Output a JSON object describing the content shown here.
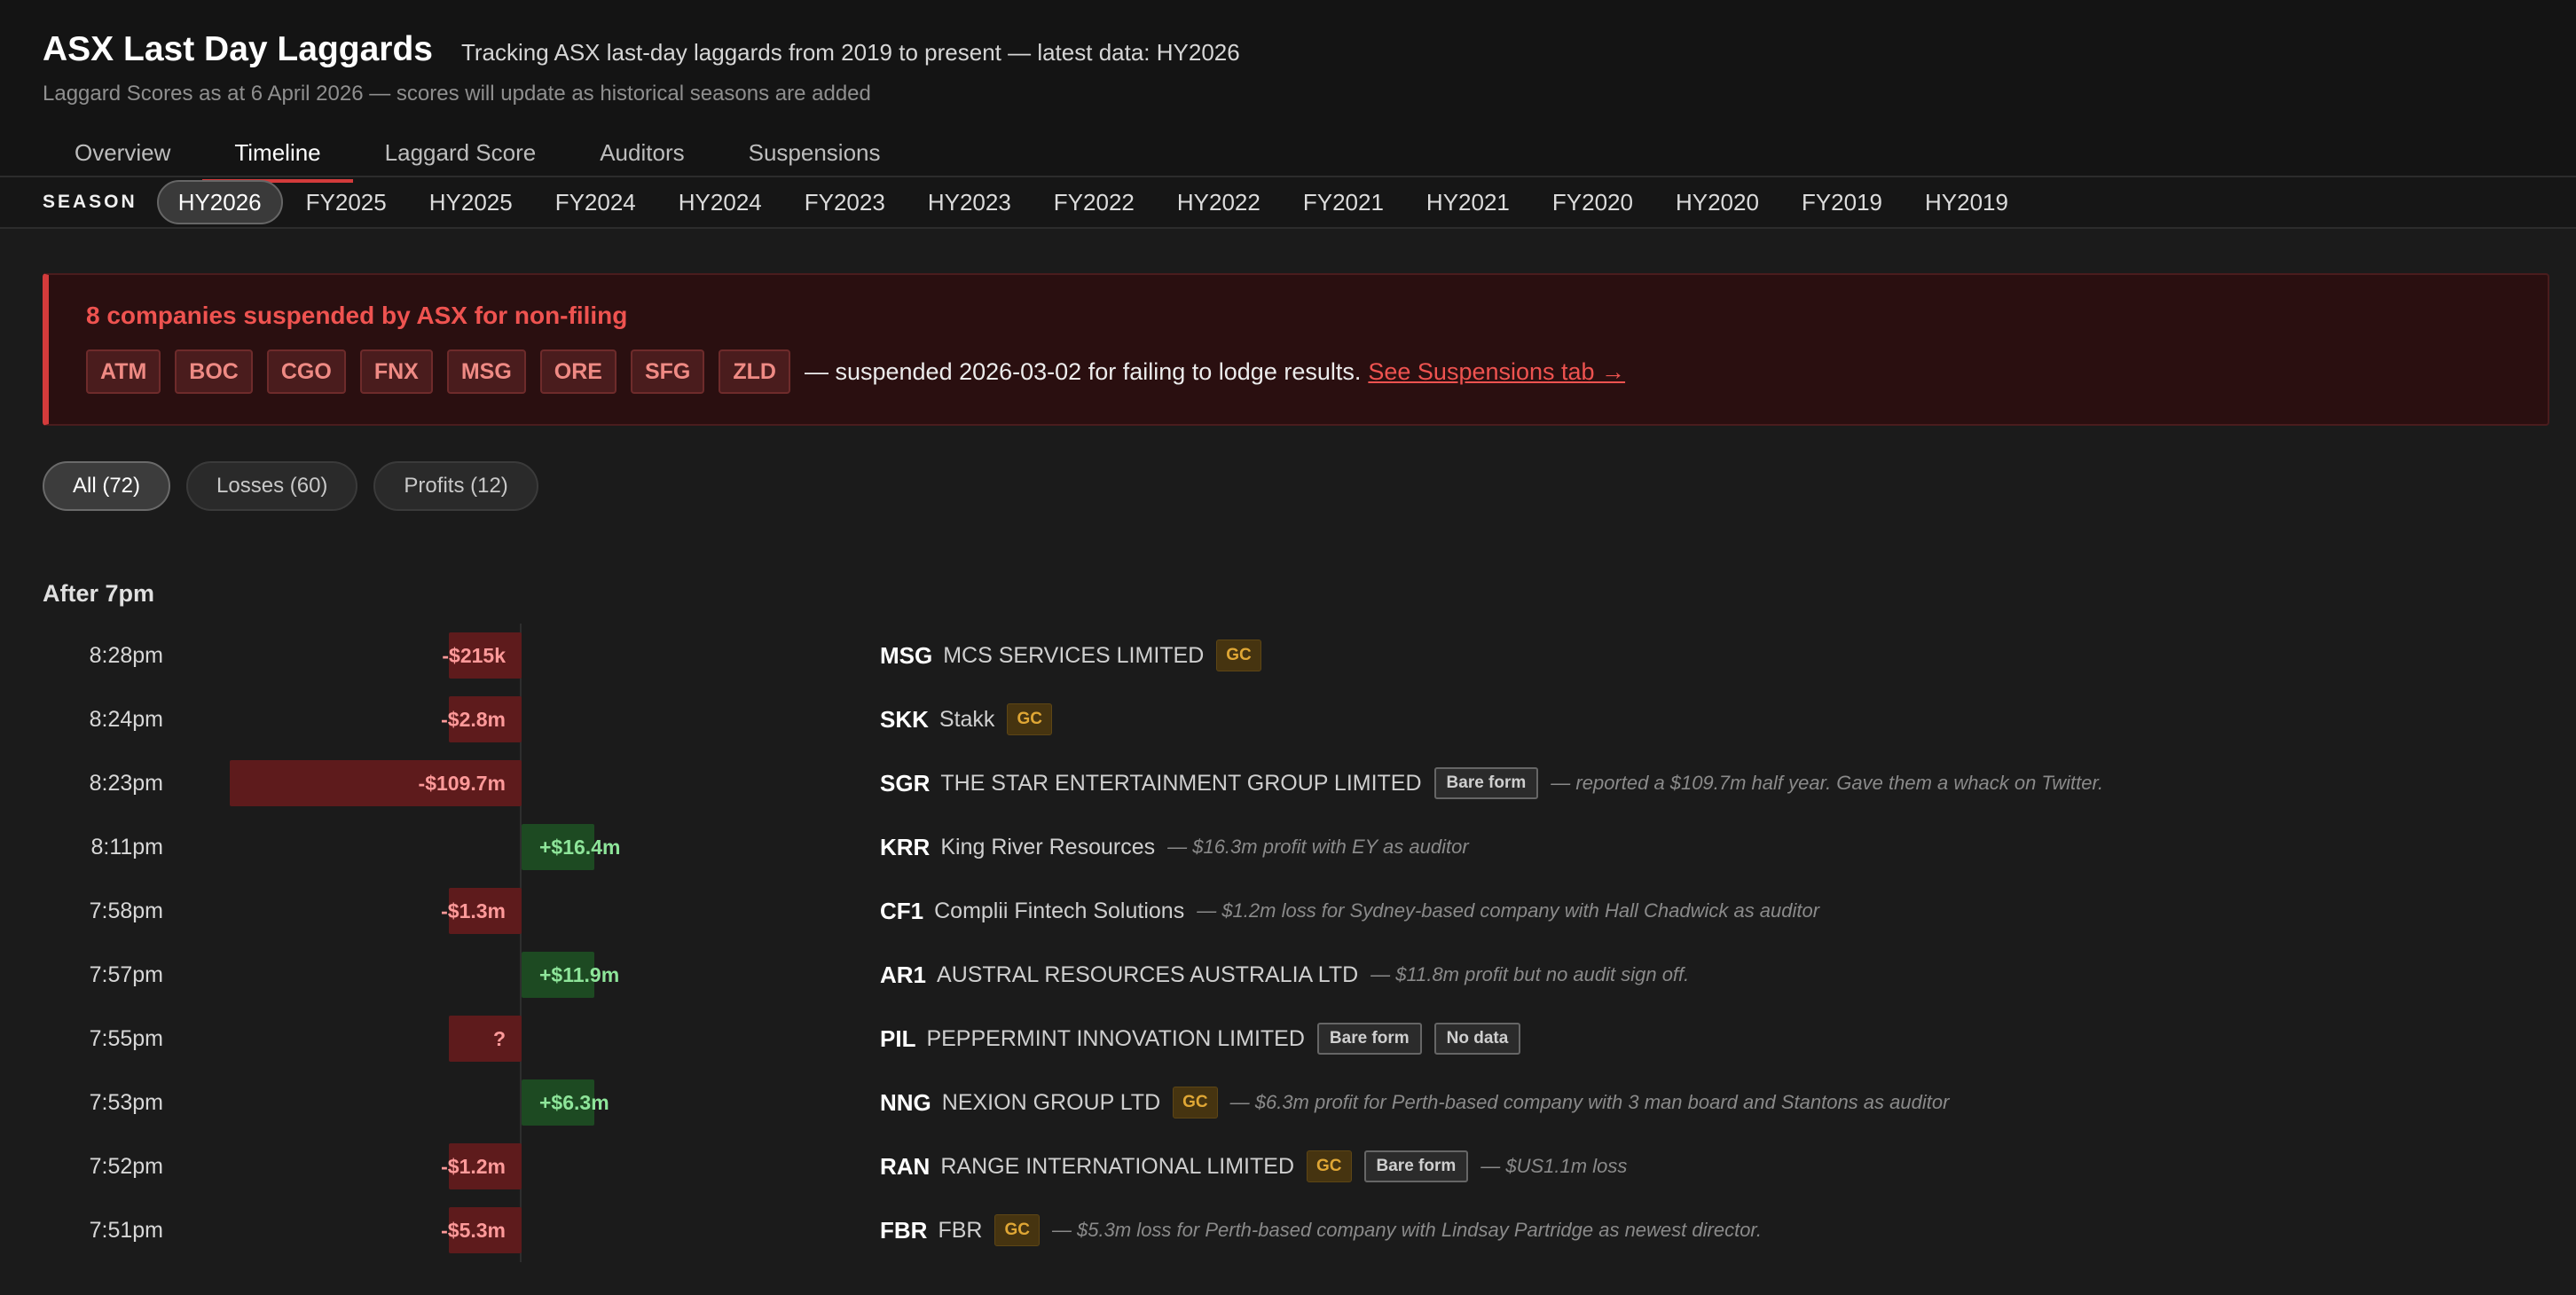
{
  "header": {
    "title": "ASX Last Day Laggards",
    "subtitle": "Tracking ASX last-day laggards from 2019 to present — latest data: HY2026",
    "note": "Laggard Scores as at 6 April 2026 — scores will update as historical seasons are added"
  },
  "tabs": [
    "Overview",
    "Timeline",
    "Laggard Score",
    "Auditors",
    "Suspensions"
  ],
  "active_tab": "Timeline",
  "season_label": "SEASON",
  "seasons": [
    "HY2026",
    "FY2025",
    "HY2025",
    "FY2024",
    "HY2024",
    "FY2023",
    "HY2023",
    "FY2022",
    "HY2022",
    "FY2021",
    "HY2021",
    "FY2020",
    "HY2020",
    "FY2019",
    "HY2019"
  ],
  "active_season": "HY2026",
  "alert": {
    "title": "8 companies suspended by ASX for non-filing",
    "codes": [
      "ATM",
      "BOC",
      "CGO",
      "FNX",
      "MSG",
      "ORE",
      "SFG",
      "ZLD"
    ],
    "text": "— suspended 2026-03-02 for failing to lodge results.",
    "link": "See Suspensions tab →"
  },
  "filters": [
    "All (72)",
    "Losses (60)",
    "Profits (12)"
  ],
  "active_filter": "All (72)",
  "section_title": "After 7pm",
  "colors": {
    "loss": "#5e1b1c",
    "profit": "#1d4a22",
    "accent": "#d33b3b",
    "gc": "#e0a735"
  },
  "rows": [
    {
      "time": "8:28pm",
      "value_m": -0.215,
      "label": "-$215k",
      "ticker": "MSG",
      "name": "MCS SERVICES LIMITED",
      "badges": [
        "GC"
      ],
      "note": ""
    },
    {
      "time": "8:24pm",
      "value_m": -2.8,
      "label": "-$2.8m",
      "ticker": "SKK",
      "name": "Stakk",
      "badges": [
        "GC"
      ],
      "note": ""
    },
    {
      "time": "8:23pm",
      "value_m": -109.7,
      "label": "-$109.7m",
      "ticker": "SGR",
      "name": "THE STAR ENTERTAINMENT GROUP LIMITED",
      "badges": [
        "Bare form"
      ],
      "note": "— reported a $109.7m half year. Gave them a whack on Twitter."
    },
    {
      "time": "8:11pm",
      "value_m": 16.4,
      "label": "+$16.4m",
      "ticker": "KRR",
      "name": "King River Resources",
      "badges": [],
      "note": "— $16.3m profit with EY as auditor"
    },
    {
      "time": "7:58pm",
      "value_m": -1.3,
      "label": "-$1.3m",
      "ticker": "CF1",
      "name": "Complii Fintech Solutions",
      "badges": [],
      "note": "— $1.2m loss for Sydney-based company with Hall Chadwick as auditor"
    },
    {
      "time": "7:57pm",
      "value_m": 11.9,
      "label": "+$11.9m",
      "ticker": "AR1",
      "name": "AUSTRAL RESOURCES AUSTRALIA LTD",
      "badges": [],
      "note": "— $11.8m profit but no audit sign off."
    },
    {
      "time": "7:55pm",
      "value_m": null,
      "label": "?",
      "ticker": "PIL",
      "name": "PEPPERMINT INNOVATION LIMITED",
      "badges": [
        "Bare form",
        "No data"
      ],
      "note": ""
    },
    {
      "time": "7:53pm",
      "value_m": 6.3,
      "label": "+$6.3m",
      "ticker": "NNG",
      "name": "NEXION GROUP LTD",
      "badges": [
        "GC"
      ],
      "note": "— $6.3m profit for Perth-based company with 3 man board and Stantons as auditor"
    },
    {
      "time": "7:52pm",
      "value_m": -1.2,
      "label": "-$1.2m",
      "ticker": "RAN",
      "name": "RANGE INTERNATIONAL LIMITED",
      "badges": [
        "GC",
        "Bare form"
      ],
      "note": "— $US1.1m loss"
    },
    {
      "time": "7:51pm",
      "value_m": -5.3,
      "label": "-$5.3m",
      "ticker": "FBR",
      "name": "FBR",
      "badges": [
        "GC"
      ],
      "note": "— $5.3m loss for Perth-based company with Lindsay Partridge as newest director."
    }
  ]
}
